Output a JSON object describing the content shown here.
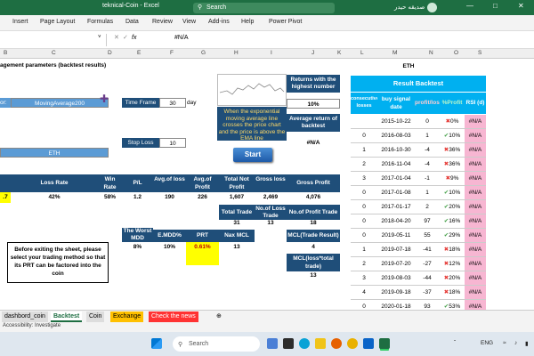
{
  "window": {
    "title": "teknical-Coin  -  Excel",
    "search_placeholder": "Search",
    "user_name": "صديقه حيدر"
  },
  "ribbon": {
    "tabs": [
      "Insert",
      "Page Layout",
      "Formulas",
      "Data",
      "Review",
      "View",
      "Add-ins",
      "Help",
      "Power Pivot"
    ]
  },
  "formula_bar": {
    "fx": "fx",
    "value": "#N/A"
  },
  "columns": [
    "B",
    "C",
    "D",
    "E",
    "F",
    "G",
    "H",
    "I",
    "J",
    "K",
    "L",
    "M",
    "N",
    "O",
    "S"
  ],
  "left": {
    "heading": "agement parameters (backtest results)",
    "indicator_label": "or:",
    "indicator_value": "MovingAverage200",
    "time_frame_label": "Time Frame",
    "time_frame_value": "30",
    "time_frame_unit": "day",
    "stop_loss_label": "Stop Loss",
    "stop_loss_value": "10",
    "coin_value": "ETH",
    "description": "When the exponential moving average line crosses the price chart and the price is above the EMA line",
    "returns_label": "Returns with the highest number",
    "returns_value": "10%",
    "avg_return_label": "Average return of backtest",
    "avg_return_value": "#N/A",
    "start_button": "Start",
    "stats_headers": [
      "Loss Rate",
      "Win Rate",
      "P/L",
      "Avg.of loss",
      "Avg.of Profit",
      "Total Not Profit",
      "Gross loss",
      "Gross Profit"
    ],
    "stats_values": [
      ".7",
      "42%",
      "58%",
      "1.2",
      "190",
      "226",
      "1,607",
      "2,469",
      "4,076"
    ],
    "trade_headers": [
      "Total Trade",
      "No.of Loss Trade",
      "No.of Profit Trade"
    ],
    "trade_values": [
      "31",
      "13",
      "18"
    ],
    "mdd_headers": [
      "The Worst MDD",
      "E.MDD%",
      "PRT",
      "Nax MCL",
      "MCL(Trade Result)"
    ],
    "mdd_values": [
      "8%",
      "10%",
      "0.61%",
      "13",
      "4"
    ],
    "mcl_label": "MCL(loss*total trade)",
    "mcl_value": "13",
    "note": "Before exiting the sheet, please select your trading method so that its PRT can be factored into the coin"
  },
  "backtest": {
    "coin": "ETH",
    "title": "Result Backtest",
    "headers": [
      "consecutive losses",
      "buy signal date",
      "profit/loss",
      "%Profit",
      "RSI (d)"
    ],
    "rows": [
      {
        "c": "",
        "date": "2015-10-22",
        "pl": "0",
        "pct": "0%",
        "mark": "x",
        "rsi": "#N/A"
      },
      {
        "c": "0",
        "date": "2016-08-03",
        "pl": "1",
        "pct": "10%",
        "mark": "v",
        "rsi": "#N/A"
      },
      {
        "c": "1",
        "date": "2016-10-30",
        "pl": "-4",
        "pct": "36%",
        "mark": "x",
        "rsi": "#N/A"
      },
      {
        "c": "2",
        "date": "2016-11-04",
        "pl": "-4",
        "pct": "36%",
        "mark": "x",
        "rsi": "#N/A"
      },
      {
        "c": "3",
        "date": "2017-01-04",
        "pl": "-1",
        "pct": "9%",
        "mark": "x",
        "rsi": "#N/A"
      },
      {
        "c": "0",
        "date": "2017-01-08",
        "pl": "1",
        "pct": "10%",
        "mark": "v",
        "rsi": "#N/A"
      },
      {
        "c": "0",
        "date": "2017-01-17",
        "pl": "2",
        "pct": "20%",
        "mark": "v",
        "rsi": "#N/A"
      },
      {
        "c": "0",
        "date": "2018-04-20",
        "pl": "97",
        "pct": "16%",
        "mark": "v",
        "rsi": "#N/A"
      },
      {
        "c": "0",
        "date": "2019-05-11",
        "pl": "55",
        "pct": "29%",
        "mark": "v",
        "rsi": "#N/A"
      },
      {
        "c": "1",
        "date": "2019-07-18",
        "pl": "-41",
        "pct": "18%",
        "mark": "x",
        "rsi": "#N/A"
      },
      {
        "c": "2",
        "date": "2019-07-20",
        "pl": "-27",
        "pct": "12%",
        "mark": "x",
        "rsi": "#N/A"
      },
      {
        "c": "3",
        "date": "2019-08-03",
        "pl": "-44",
        "pct": "20%",
        "mark": "x",
        "rsi": "#N/A"
      },
      {
        "c": "4",
        "date": "2019-09-18",
        "pl": "-37",
        "pct": "18%",
        "mark": "x",
        "rsi": "#N/A"
      },
      {
        "c": "0",
        "date": "2020-01-18",
        "pl": "93",
        "pct": "53%",
        "mark": "v",
        "rsi": "#N/A"
      },
      {
        "c": "0",
        "date": "2020-01-28",
        "pl": "51",
        "pct": "29%",
        "mark": "v",
        "rsi": "#N/A"
      }
    ]
  },
  "sheet_tabs": [
    "dashbord_coin",
    "Backtest",
    "Coin",
    "Exchange",
    "Check the news"
  ],
  "status": {
    "accessibility": "Accessibility: Investigate"
  },
  "taskbar": {
    "search": "Search",
    "lang": "ENG"
  },
  "colors": {
    "excel_green": "#1e6e42",
    "header_blue": "#1f4e79",
    "result_cyan": "#00b0f0",
    "pink": "#f7b6d2"
  }
}
